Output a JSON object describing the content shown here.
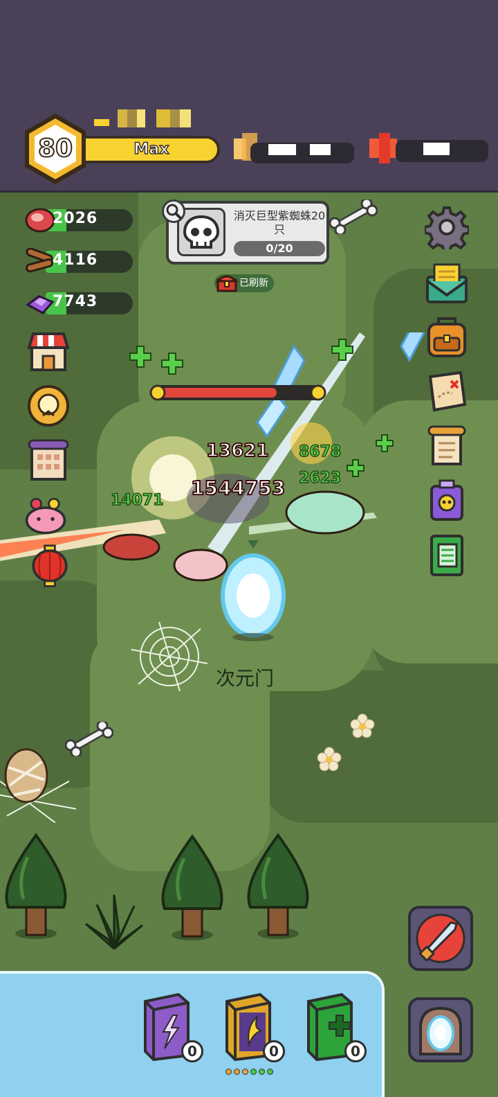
{
  "player": {
    "level": "80",
    "xp_label": "Max"
  },
  "resources": [
    {
      "name": "meat",
      "icon": "meat-icon",
      "value": "2026"
    },
    {
      "name": "wood",
      "icon": "wood-icon",
      "value": "4116"
    },
    {
      "name": "crystal",
      "icon": "crystal-icon",
      "value": "7743"
    }
  ],
  "quest": {
    "title": "消灭巨型紫蜘蛛20只",
    "progress": "0/20",
    "progress_fraction": 0,
    "refresh_label": "已刷新"
  },
  "battle": {
    "damage_numbers": [
      "13621",
      "1544753"
    ],
    "heal_numbers": [
      "8678",
      "2623",
      "14071"
    ],
    "portal_label": "次元门"
  },
  "skill_books": [
    {
      "name": "lightning-book",
      "color": "#8e5cc8",
      "count": "0"
    },
    {
      "name": "wing-book",
      "color": "#e0a62a",
      "count": "0"
    },
    {
      "name": "heal-book",
      "color": "#2ca43a",
      "count": "0"
    }
  ],
  "colors": {
    "header": "#4a4159",
    "grass": "#5f7f46",
    "xp_bar": "#f8d231",
    "level_hex": "#f3b92f",
    "bottom_bar": "#8fd1ee"
  }
}
